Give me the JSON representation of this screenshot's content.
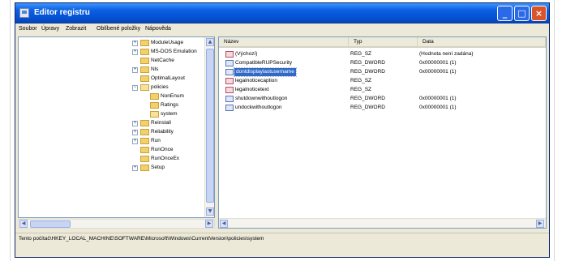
{
  "window": {
    "title": "Editor registru",
    "min_symbol": "_",
    "max_symbol": "□",
    "close_symbol": "×"
  },
  "menu": [
    "Soubor",
    "Úpravy",
    "Zobrazit",
    "Oblíbené položky",
    "Nápověda"
  ],
  "tree": {
    "items": [
      {
        "label": "ModuleUsage",
        "expander": "+",
        "open": false
      },
      {
        "label": "MS-DOS Emulation",
        "expander": "+",
        "open": false
      },
      {
        "label": "NetCache",
        "expander": "",
        "open": false
      },
      {
        "label": "Nls",
        "expander": "+",
        "open": false
      },
      {
        "label": "OptimalLayout",
        "expander": "",
        "open": false
      },
      {
        "label": "policies",
        "expander": "−",
        "open": true
      },
      {
        "label": "NonEnum",
        "expander": "",
        "open": false
      },
      {
        "label": "Ratings",
        "expander": "",
        "open": false
      },
      {
        "label": "system",
        "expander": "",
        "open": true
      },
      {
        "label": "Reinstall",
        "expander": "+",
        "open": false
      },
      {
        "label": "Reliability",
        "expander": "+",
        "open": false
      },
      {
        "label": "Run",
        "expander": "+",
        "open": false
      },
      {
        "label": "RunOnce",
        "expander": "",
        "open": false
      },
      {
        "label": "RunOnceEx",
        "expander": "",
        "open": false
      },
      {
        "label": "Setup",
        "expander": "+",
        "open": false
      }
    ]
  },
  "values": {
    "headers": {
      "name": "Název",
      "type": "Typ",
      "data": "Data"
    },
    "rows": [
      {
        "name": "(Výchozí)",
        "type": "REG_SZ",
        "data": "(Hodnota není zadána)",
        "icon": "str",
        "selected": false
      },
      {
        "name": "CompatibleRUPSecurity",
        "type": "REG_DWORD",
        "data": "0x00000001 (1)",
        "icon": "bin",
        "selected": false
      },
      {
        "name": "dontdisplaylastusername",
        "type": "REG_DWORD",
        "data": "0x00000001 (1)",
        "icon": "bin",
        "selected": true
      },
      {
        "name": "legalnoticecaption",
        "type": "REG_SZ",
        "data": "",
        "icon": "str",
        "selected": false
      },
      {
        "name": "legalnoticetext",
        "type": "REG_SZ",
        "data": "",
        "icon": "str",
        "selected": false
      },
      {
        "name": "shutdownwithoutlogon",
        "type": "REG_DWORD",
        "data": "0x00000001 (1)",
        "icon": "bin",
        "selected": false
      },
      {
        "name": "undockwithoutlogon",
        "type": "REG_DWORD",
        "data": "0x00000001 (1)",
        "icon": "bin",
        "selected": false
      }
    ]
  },
  "statusbar": {
    "path": "Tento počítač\\HKEY_LOCAL_MACHINE\\SOFTWARE\\Microsoft\\Windows\\CurrentVersion\\policies\\system"
  }
}
